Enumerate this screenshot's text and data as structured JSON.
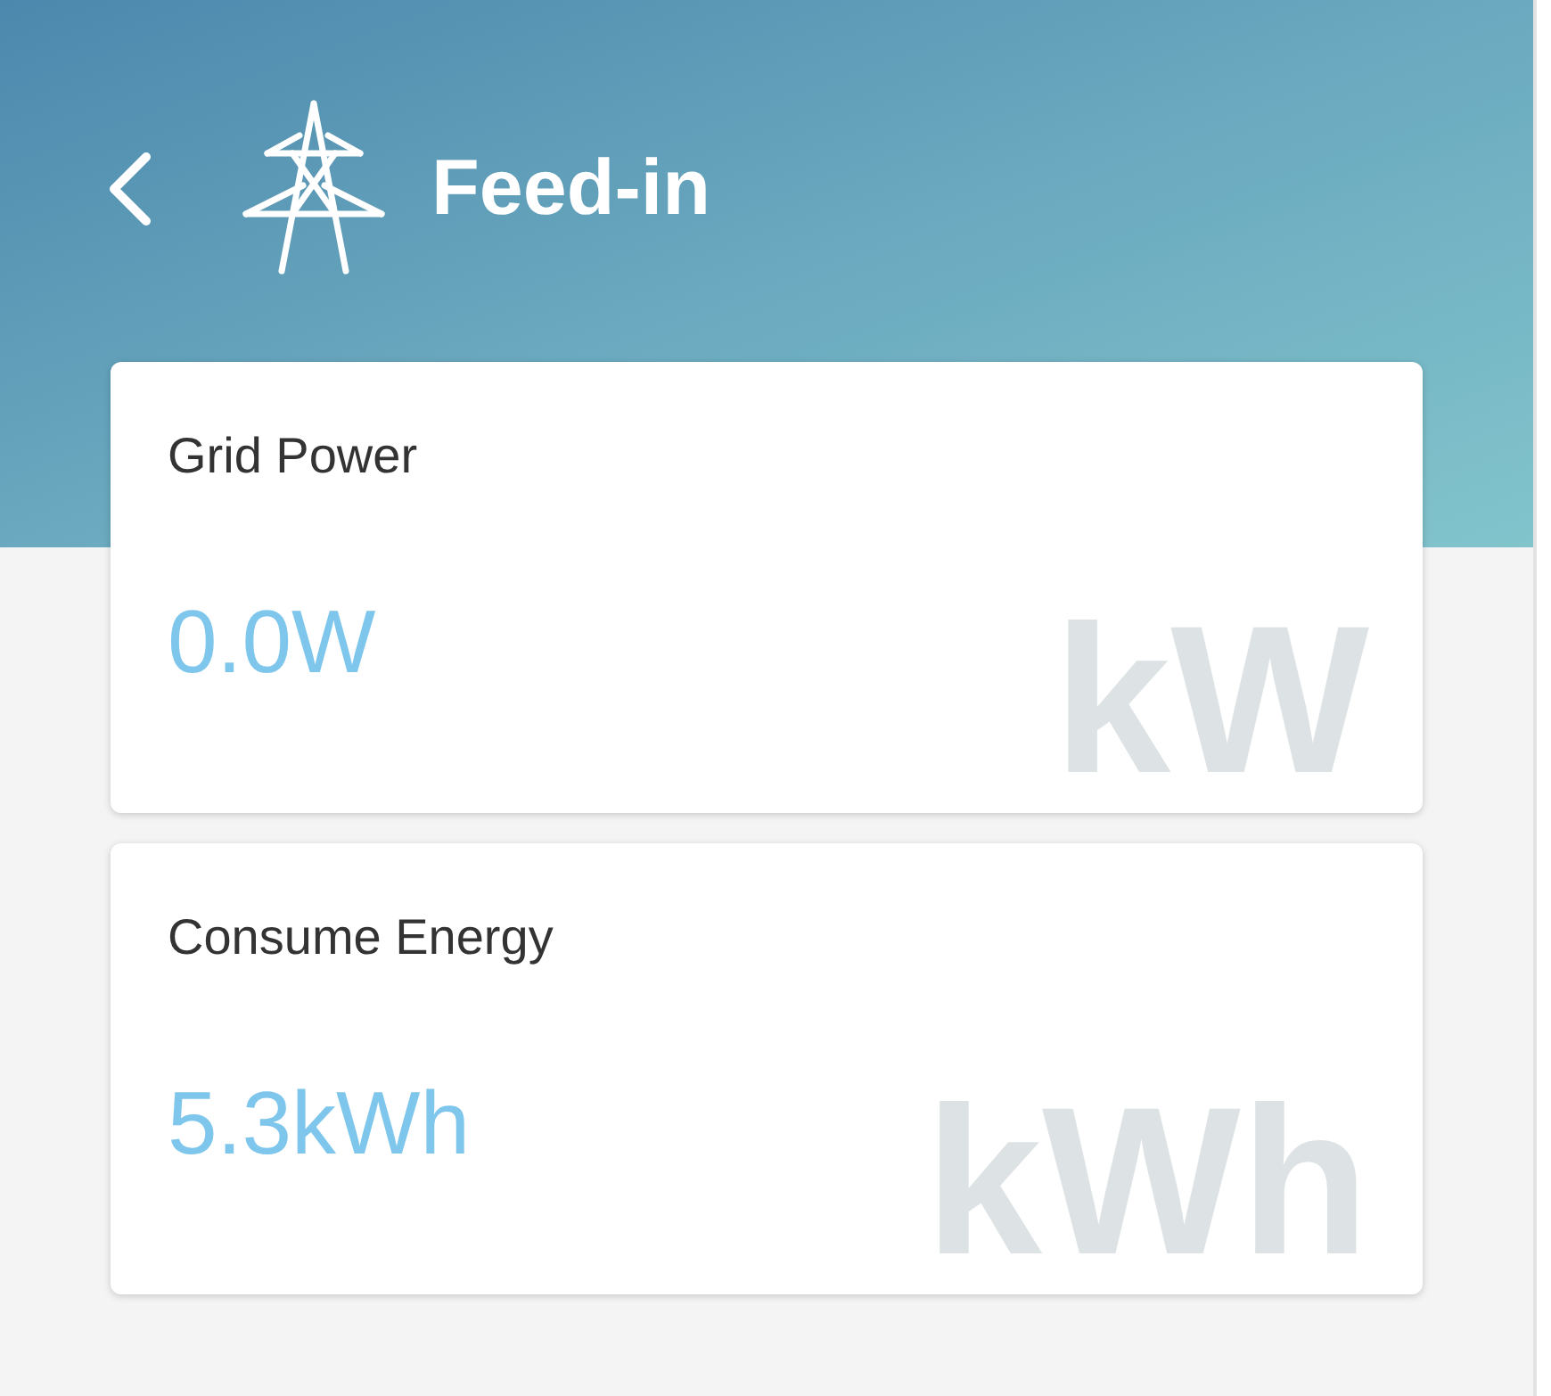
{
  "header": {
    "title": "Feed-in"
  },
  "cards": [
    {
      "label": "Grid Power",
      "value": "0.0W",
      "watermark": "kW"
    },
    {
      "label": "Consume Energy",
      "value": "5.3kWh",
      "watermark": "kWh"
    }
  ]
}
